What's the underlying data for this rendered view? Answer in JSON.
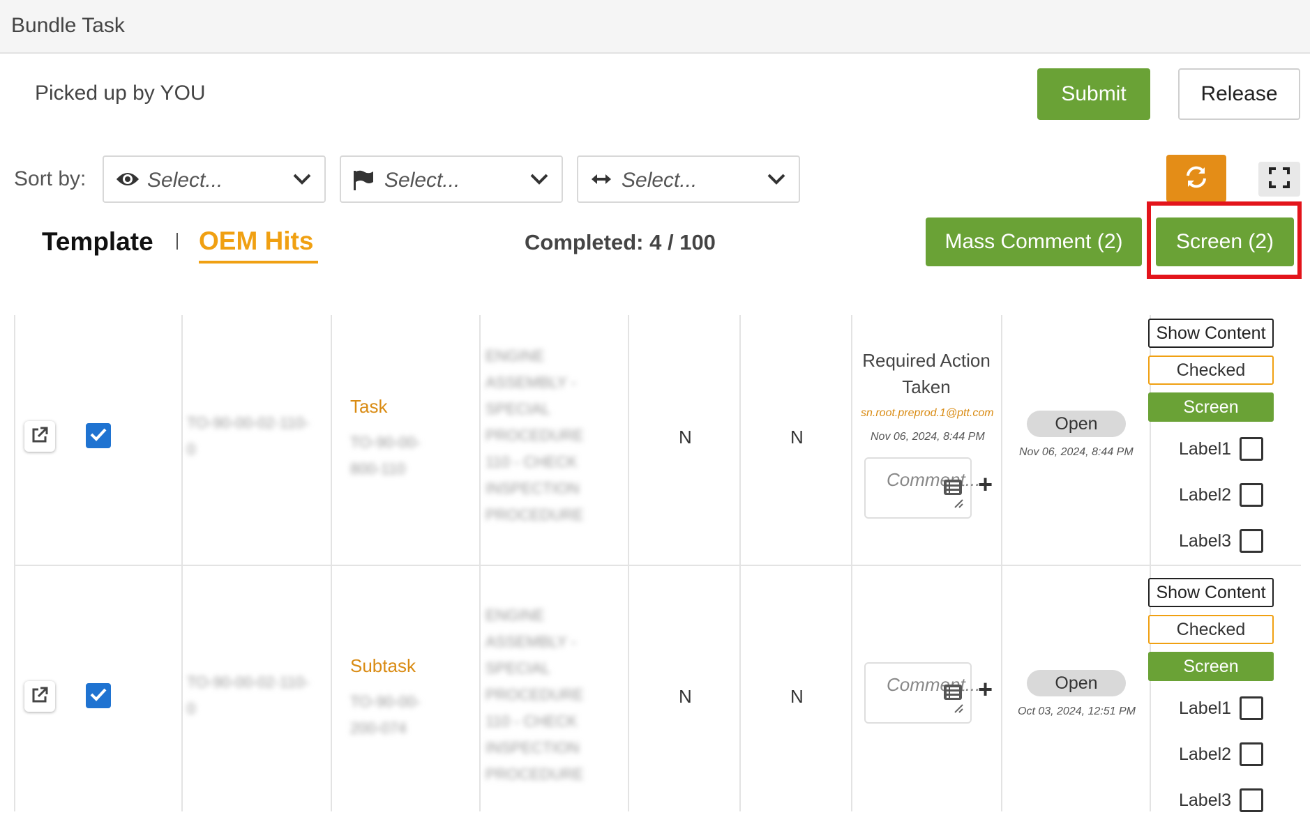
{
  "window": {
    "title": "Bundle Task"
  },
  "header": {
    "picked_by": "Picked up by YOU",
    "submit_label": "Submit",
    "release_label": "Release"
  },
  "sort": {
    "label": "Sort by:",
    "selects": [
      {
        "icon": "eye-icon",
        "placeholder": "Select..."
      },
      {
        "icon": "flag-icon",
        "placeholder": "Select..."
      },
      {
        "icon": "arrows-horizontal-icon",
        "placeholder": "Select..."
      }
    ]
  },
  "tabs": {
    "template": "Template",
    "separator": "I",
    "oem_hits": "OEM Hits"
  },
  "completed": {
    "label": "Completed:",
    "value": "4 / 100"
  },
  "actions": {
    "mass_comment": "Mass Comment (2)",
    "screen": "Screen (2)"
  },
  "colors": {
    "green": "#6aa236",
    "orange": "#e48d17",
    "accent_orange_text": "#f0a012",
    "highlight_red": "#e3141b",
    "checkbox_blue": "#1f73d1"
  },
  "rows": [
    {
      "id_blurred": [
        "TO-90-00-02-110-",
        "0"
      ],
      "type": "Task",
      "type_sub_blurred": [
        "TO-90-00-",
        "800-110"
      ],
      "desc_blurred": [
        "ENGINE",
        "ASSEMBLY -",
        "SPECIAL",
        "PROCEDURE",
        "110 - CHECK",
        "INSPECTION",
        "PROCEDURE"
      ],
      "col_n1": "N",
      "col_n2": "N",
      "required_action": "Required Action Taken",
      "email": "sn.root.preprod.1@ptt.com",
      "action_date": "Nov 06, 2024, 8:44 PM",
      "comment_placeholder": "Comment...",
      "status": "Open",
      "status_date": "Nov 06, 2024, 8:44 PM",
      "btn_show": "Show Content",
      "btn_checked": "Checked",
      "btn_screen": "Screen",
      "labels": [
        "Label1",
        "Label2",
        "Label3"
      ]
    },
    {
      "id_blurred": [
        "TO-90-00-02-110-",
        "0"
      ],
      "type": "Subtask",
      "type_sub_blurred": [
        "TO-90-00-",
        "200-074"
      ],
      "desc_blurred": [
        "ENGINE",
        "ASSEMBLY -",
        "SPECIAL",
        "PROCEDURE",
        "110 - CHECK",
        "INSPECTION",
        "PROCEDURE"
      ],
      "col_n1": "N",
      "col_n2": "N",
      "comment_placeholder": "Comment...",
      "status": "Open",
      "status_date": "Oct 03, 2024, 12:51 PM",
      "btn_show": "Show Content",
      "btn_checked": "Checked",
      "btn_screen": "Screen",
      "labels": [
        "Label1",
        "Label2",
        "Label3"
      ]
    }
  ]
}
